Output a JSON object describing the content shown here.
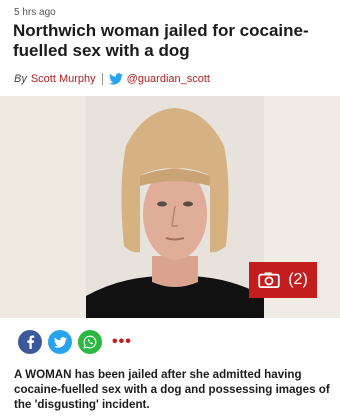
{
  "article": {
    "timestamp": "5 hrs ago",
    "headline": "Northwich woman jailed for cocaine-fuelled sex with a dog",
    "byline": {
      "prefix": "By",
      "author": "Scott Murphy",
      "twitter_handle": "@guardian_scott"
    },
    "gallery": {
      "count_label": "(2)"
    },
    "share": {
      "more_label": "•••"
    },
    "lede": "A WOMAN has been jailed after she admitted having cocaine-fuelled sex with a dog and possessing images of the 'disgusting' incident."
  },
  "icons": {
    "twitter": "twitter-bird-icon",
    "camera": "camera-icon",
    "facebook": "facebook-icon",
    "whatsapp": "whatsapp-icon"
  },
  "colors": {
    "accent": "#c31d1d",
    "author_link": "#b51e1e",
    "facebook": "#3b5998",
    "twitter": "#2aa3ef",
    "whatsapp": "#2bb741"
  }
}
